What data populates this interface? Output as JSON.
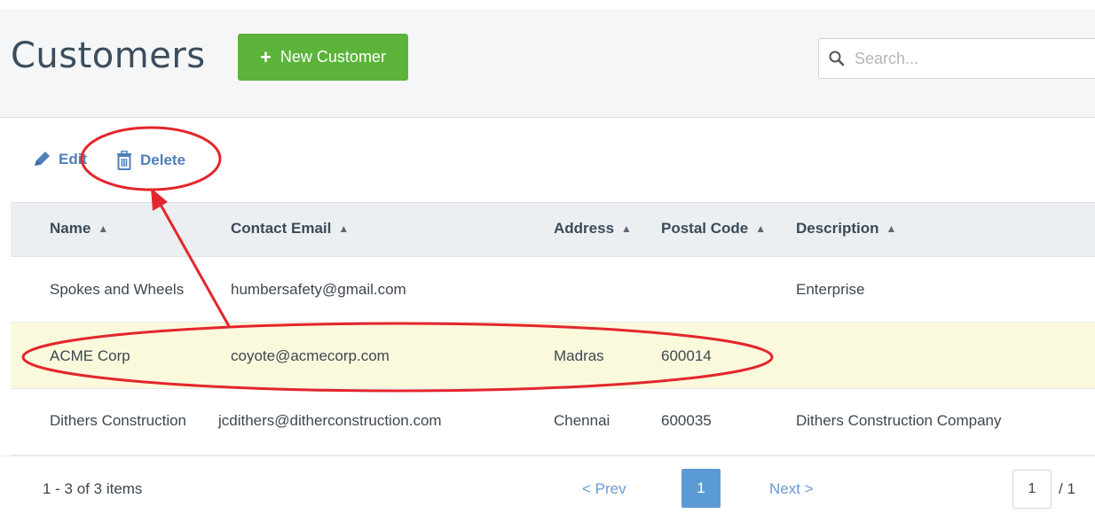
{
  "header": {
    "title": "Customers",
    "new_button_label": "New Customer",
    "search_placeholder": "Search..."
  },
  "toolbar": {
    "edit_label": "Edit",
    "delete_label": "Delete"
  },
  "table": {
    "columns": [
      {
        "label": "Name"
      },
      {
        "label": "Contact Email"
      },
      {
        "label": "Address"
      },
      {
        "label": "Postal Code"
      },
      {
        "label": "Description"
      }
    ],
    "rows": [
      {
        "name": "Spokes and Wheels",
        "email": "humbersafety@gmail.com",
        "address": "",
        "postal": "",
        "description": "Enterprise",
        "selected": false
      },
      {
        "name": "ACME Corp",
        "email": "coyote@acmecorp.com",
        "address": "Madras",
        "postal": "600014",
        "description": "",
        "selected": true
      },
      {
        "name": "Dithers Construction",
        "email": "jcdithers@ditherconstruction.com",
        "address": "Chennai",
        "postal": "600035",
        "description": "Dithers Construction Company",
        "selected": false
      }
    ]
  },
  "pagination": {
    "summary": "1 - 3 of 3 items",
    "prev_label": "< Prev",
    "current_page": "1",
    "next_label": "Next >",
    "page_input_value": "1",
    "total_pages_label": "/ 1"
  },
  "colors": {
    "accent_green": "#5cb33a",
    "link_blue": "#4f7fb8",
    "selected_row": "#fbf9dc",
    "annotation_red": "#e3262b"
  }
}
